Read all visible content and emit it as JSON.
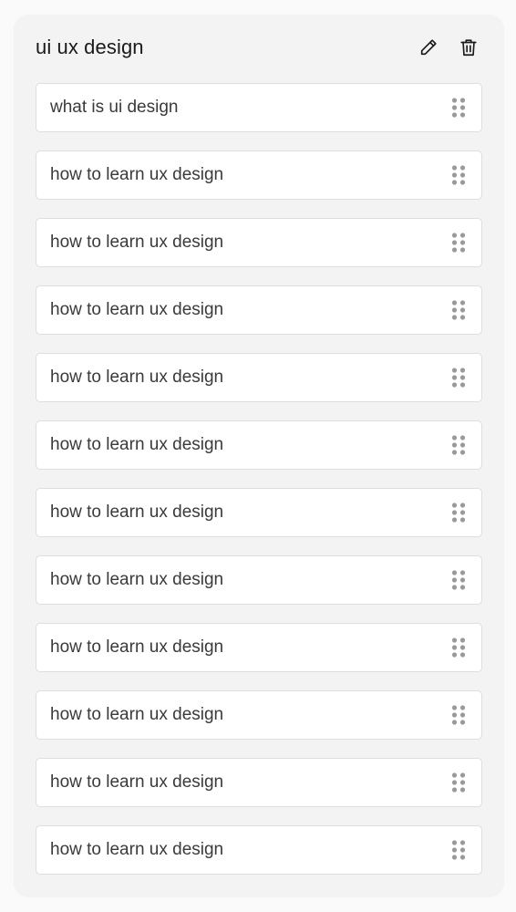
{
  "group": {
    "title": "ui ux design",
    "icons": {
      "edit": "pencil-icon",
      "delete": "trash-icon",
      "drag": "drag-handle-icon"
    }
  },
  "items": [
    {
      "label": "what is ui design"
    },
    {
      "label": "how to learn ux design"
    },
    {
      "label": "how to learn ux design"
    },
    {
      "label": "how to learn ux design"
    },
    {
      "label": "how to learn ux design"
    },
    {
      "label": "how to learn ux design"
    },
    {
      "label": "how to learn ux design"
    },
    {
      "label": "how to learn ux design"
    },
    {
      "label": "how to learn ux design"
    },
    {
      "label": "how to learn ux design"
    },
    {
      "label": "how to learn ux design"
    },
    {
      "label": "how to learn ux design"
    }
  ],
  "colors": {
    "card_bg": "#f3f3f3",
    "item_bg": "#ffffff",
    "item_border": "#dedede",
    "text": "#3a3a3a",
    "icon": "#1a1a1a",
    "drag_dots": "#9a9a9a"
  }
}
